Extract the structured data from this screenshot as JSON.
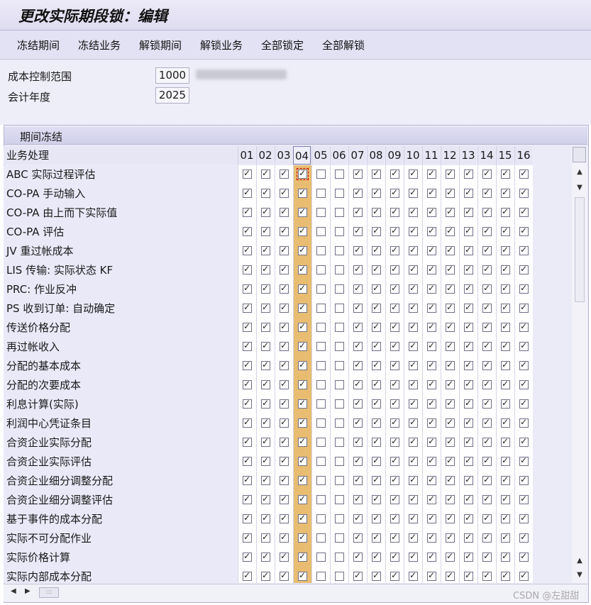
{
  "title": "更改实际期段锁：编辑",
  "toolbar": [
    "冻结期间",
    "冻结业务",
    "解锁期间",
    "解锁业务",
    "全部锁定",
    "全部解锁"
  ],
  "header": {
    "controlling_area_label": "成本控制范围",
    "controlling_area_value": "1000",
    "fiscal_year_label": "会计年度",
    "fiscal_year_value": "2025"
  },
  "panel_title": "期间冻结",
  "grid": {
    "process_header": "业务处理",
    "periods": [
      "01",
      "02",
      "03",
      "04",
      "05",
      "06",
      "07",
      "08",
      "09",
      "10",
      "11",
      "12",
      "13",
      "14",
      "15",
      "16"
    ],
    "highlight_period": "04",
    "checked_pattern": [
      true,
      true,
      true,
      true,
      false,
      false,
      true,
      true,
      true,
      true,
      true,
      true,
      true,
      true,
      true,
      true
    ],
    "rows": [
      "ABC 实际过程评估",
      "CO-PA 手动输入",
      "CO-PA 由上而下实际值",
      "CO-PA 评估",
      "JV 重过帐成本",
      "LIS 传输: 实际状态 KF",
      "PRC: 作业反冲",
      "PS 收到订单: 自动确定",
      "传送价格分配",
      "再过帐收入",
      "分配的基本成本",
      "分配的次要成本",
      "利息计算(实际)",
      "利润中心凭证条目",
      "合资企业实际分配",
      "合资企业实际评估",
      "合资企业细分调整分配",
      "合资企业细分调整评估",
      "基于事件的成本分配",
      "实际不可分配作业",
      "实际价格计算",
      "实际内部成本分配"
    ]
  },
  "watermark": "CSDN @左甜甜"
}
